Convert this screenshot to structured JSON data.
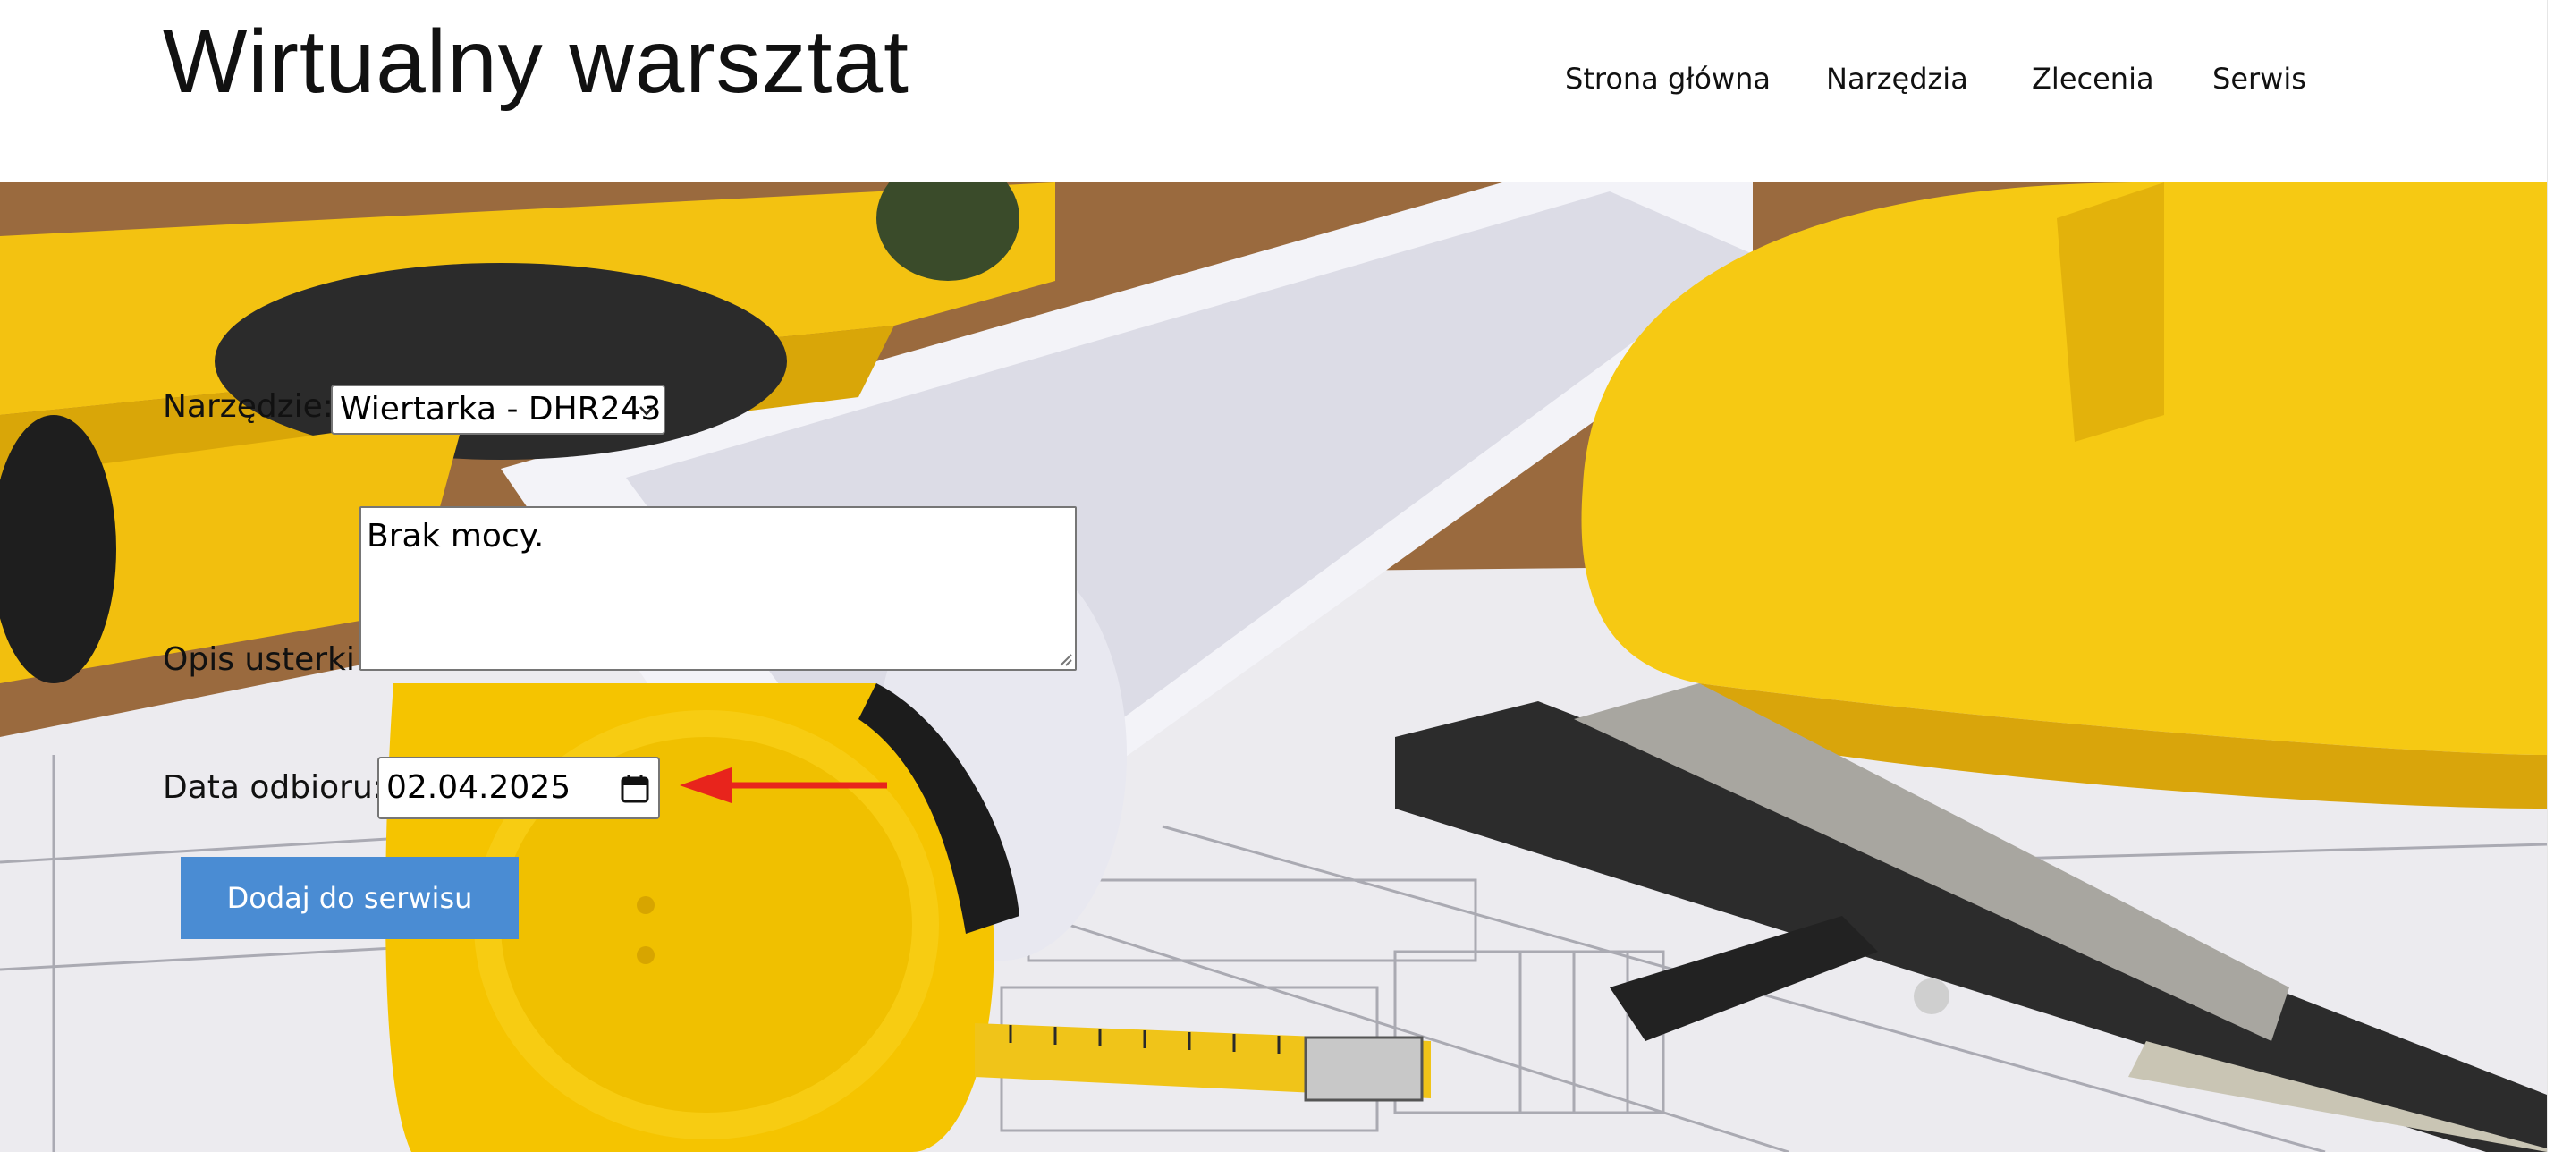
{
  "header": {
    "title": "Wirtualny warsztat",
    "nav": [
      "Strona główna",
      "Narzędzia",
      "Zlecenia",
      "Serwis"
    ]
  },
  "form": {
    "tool_label": "Narzędzie:",
    "tool_value": "Wiertarka - DHR243",
    "fault_label": "Opis usterki:",
    "fault_value": "Brak mocy.",
    "date_label": "Data odbioru:",
    "date_value": "02.04.2025",
    "submit_label": "Dodaj do serwisu"
  },
  "colors": {
    "button": "#4a8cd3",
    "annotation_arrow": "#e8241c",
    "accent_yellow": "#f5c400"
  },
  "icons": [
    "chevron-down-icon",
    "calendar-icon",
    "resize-grip-icon",
    "annotation-arrow"
  ]
}
